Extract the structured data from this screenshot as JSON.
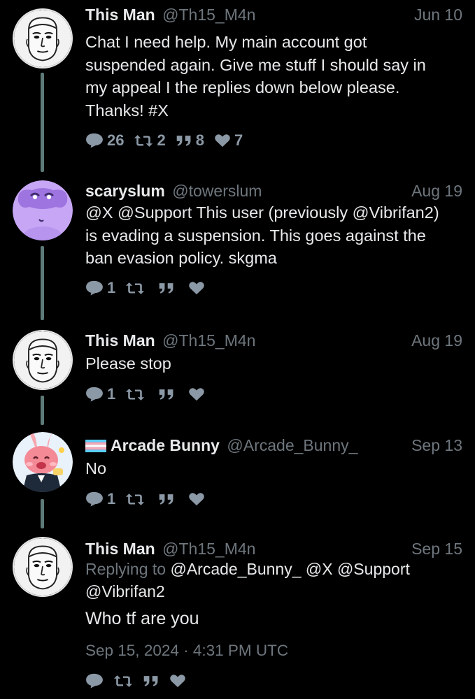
{
  "colors": {
    "background": "#000000",
    "text": "#e7e9ea",
    "muted": "#6e767d",
    "thread_line": "#5d7a78"
  },
  "tweets": [
    {
      "name": "This Man",
      "handle": "@Th15_M4n",
      "date": "Jun 10",
      "avatar": "hand-drawn-face-avatar",
      "text_lines": [
        "Chat I need help. My main account got",
        "suspended again. Give me stuff I should say in",
        "my appeal I the replies down below please.",
        "Thanks! #X"
      ],
      "replies": "26",
      "retweets": "2",
      "quotes": "8",
      "likes": "7"
    },
    {
      "name": "scaryslum",
      "handle": "@towerslum",
      "date": "Aug 19",
      "avatar": "purple-cartoon-avatar",
      "text_lines": [
        "@X @Support This user (previously @Vibrifan2)",
        "is evading a suspension. This goes against the",
        "ban evasion policy. skgma"
      ],
      "replies": "1",
      "retweets": "",
      "quotes": "",
      "likes": ""
    },
    {
      "name": "This Man",
      "handle": "@Th15_M4n",
      "date": "Aug 19",
      "avatar": "hand-drawn-face-avatar",
      "text_lines": [
        "Please stop"
      ],
      "replies": "1",
      "retweets": "",
      "quotes": "",
      "likes": ""
    },
    {
      "name": "Arcade Bunny",
      "name_prefix_icon": "transgender-flag-icon",
      "handle": "@Arcade_Bunny_",
      "date": "Sep 13",
      "avatar": "pink-bunny-avatar",
      "text_lines": [
        "No"
      ],
      "replies": "1",
      "retweets": "",
      "quotes": "",
      "likes": ""
    },
    {
      "name": "This Man",
      "handle": "@Th15_M4n",
      "date": "Sep 15",
      "avatar": "hand-drawn-face-avatar",
      "replying_to_label": "Replying to",
      "replying_to_line1": "@Arcade_Bunny_ @X @Support",
      "replying_to_line2": "@Vibrifan2",
      "text_lines": [
        "Who tf are you"
      ],
      "timestamp": "Sep 15, 2024 · 4:31 PM UTC",
      "replies": "",
      "retweets": "",
      "quotes": "",
      "likes": ""
    }
  ]
}
